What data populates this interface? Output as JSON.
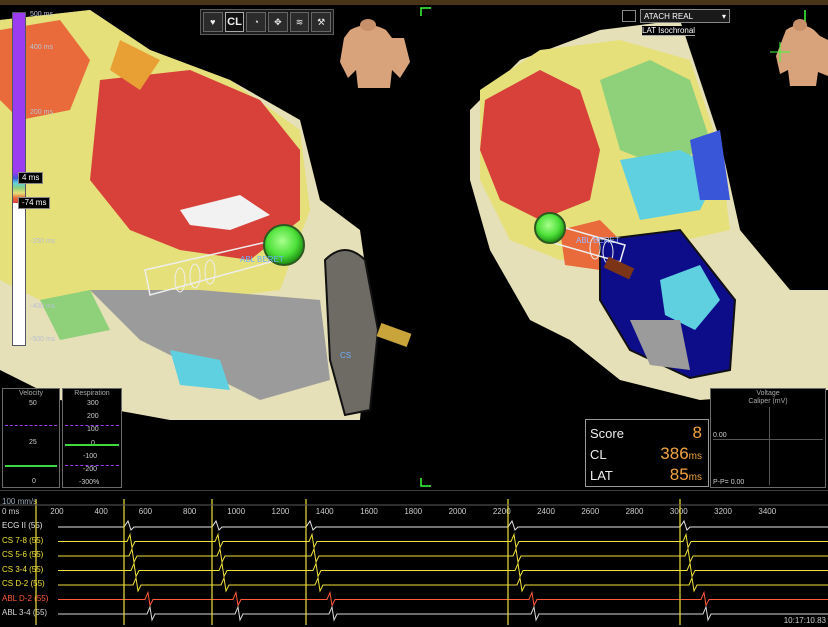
{
  "colors": {
    "accent": "#f2a443",
    "ecg": "#e6e6e6",
    "cs": "#f0e03a",
    "abl": "#ff5a3c",
    "green_marker": "#4ee13a",
    "purple_scale": "#9b3cf0"
  },
  "color_scale": {
    "labels": [
      "500 ms",
      "400 ms",
      "200 ms",
      "4 ms",
      "-74 ms",
      "-200 ms",
      "-400 ms",
      "-500 ms"
    ]
  },
  "toolbar": {
    "cl_label": "CL",
    "icons": [
      "ecg-icon",
      "gauge-icon",
      "move-icon",
      "waveform-icon",
      "tool-icon"
    ]
  },
  "map_select": {
    "value": "ATACH REAL",
    "mode": "LAT Isochronal"
  },
  "annotations": {
    "abl_left": "ABL BERET",
    "abl_right": "ABL BERET",
    "cs_label": "CS"
  },
  "velocity_panel": {
    "title": "Velocity",
    "ticks": [
      "50",
      "25",
      "0"
    ]
  },
  "respiration_panel": {
    "title": "Respiration",
    "ticks": [
      "300",
      "200",
      "100",
      "0",
      "-100",
      "-200",
      "-300%"
    ]
  },
  "voltage_panel": {
    "title": "Voltage\nCaliper (mV)",
    "value": "0.00",
    "footer": "P-P= 0.00"
  },
  "score": {
    "score_label": "Score",
    "score_value": "8",
    "cl_label": "CL",
    "cl_value": "386",
    "cl_unit": "ms",
    "lat_label": "LAT",
    "lat_value": "85",
    "lat_unit": "ms"
  },
  "strip": {
    "speed": "100 mm/s",
    "ticks": [
      "0 ms",
      "200",
      "400",
      "600",
      "800",
      "1000",
      "1200",
      "1400",
      "1600",
      "1800",
      "2000",
      "2200",
      "2400",
      "2600",
      "2800",
      "3000",
      "3200",
      "3400"
    ],
    "channels": [
      {
        "name": "ECG II (55)",
        "type": "ecg"
      },
      {
        "name": "CS 7-8 (55)",
        "type": "cs"
      },
      {
        "name": "CS 5-6 (55)",
        "type": "cs"
      },
      {
        "name": "CS 3-4 (55)",
        "type": "cs"
      },
      {
        "name": "CS D-2 (55)",
        "type": "cs"
      },
      {
        "name": "ABL D-2 (55)",
        "type": "abl"
      },
      {
        "name": "ABL 3-4 (55)",
        "type": "abl2"
      }
    ],
    "timestamp": "10:17:10.83"
  }
}
